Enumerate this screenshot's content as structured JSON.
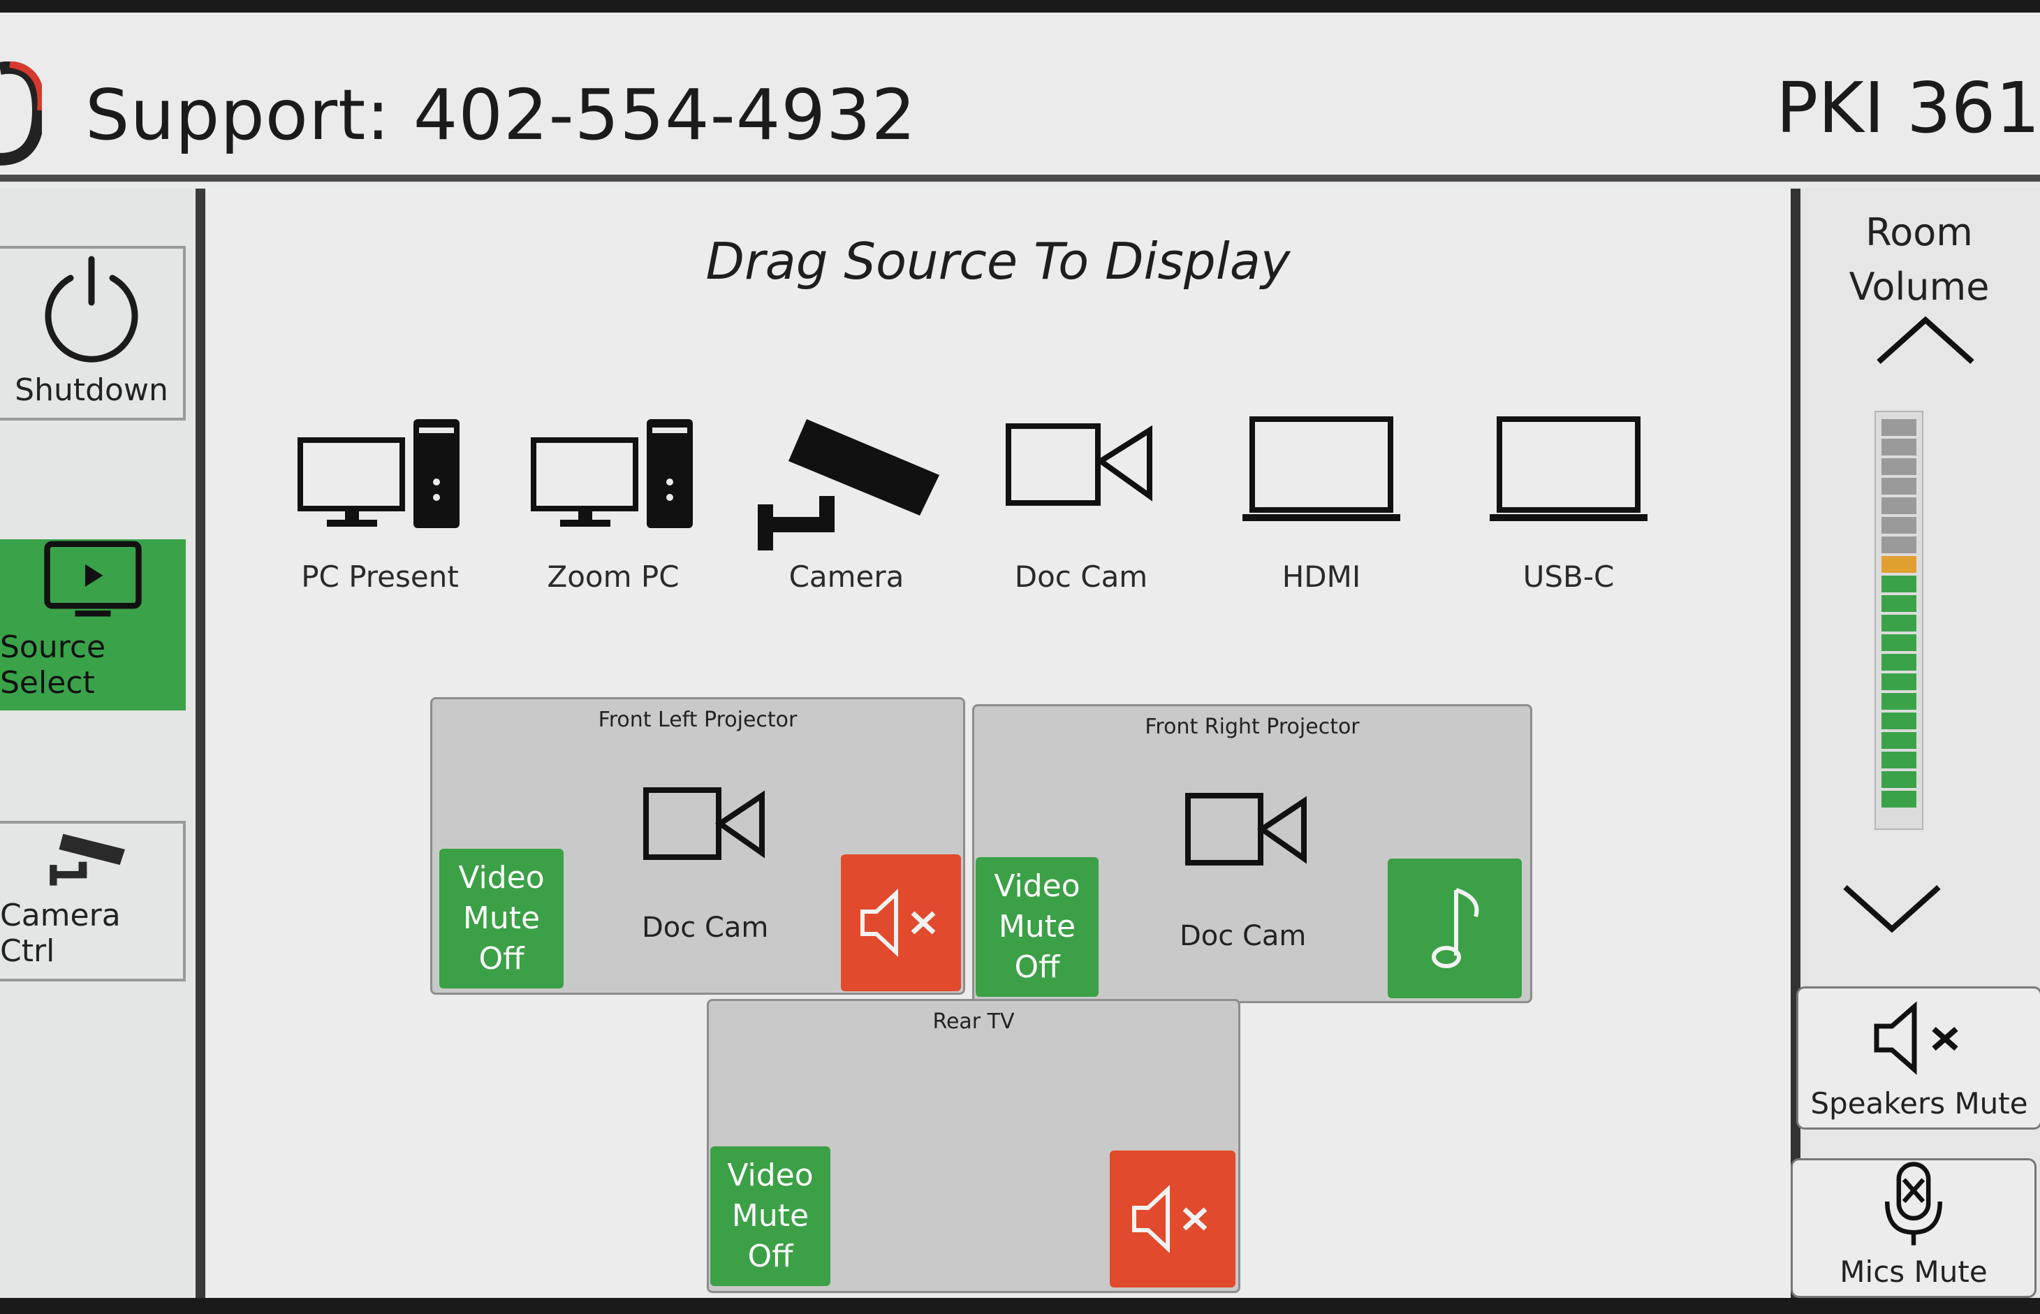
{
  "header": {
    "support_text": "Support: 402-554-4932",
    "room_name": "PKI 361"
  },
  "nav": {
    "shutdown_label": "Shutdown",
    "source_select_label": "Source Select",
    "camera_ctrl_label": "Camera Ctrl",
    "active": "Source Select"
  },
  "main": {
    "title": "Drag Source To Display",
    "sources": [
      {
        "label": "PC Present",
        "icon": "pc-icon"
      },
      {
        "label": "Zoom PC",
        "icon": "pc-icon"
      },
      {
        "label": "Camera",
        "icon": "security-camera-icon"
      },
      {
        "label": "Doc Cam",
        "icon": "video-camera-icon"
      },
      {
        "label": "HDMI",
        "icon": "laptop-icon"
      },
      {
        "label": "USB-C",
        "icon": "laptop-icon"
      }
    ]
  },
  "displays": {
    "front_left": {
      "title": "Front Left Projector",
      "source": "Doc Cam",
      "video_mute": "Video\nMute\nOff",
      "audio": "muted"
    },
    "front_right": {
      "title": "Front Right Projector",
      "source": "Doc Cam",
      "video_mute": "Video\nMute\nOff",
      "audio": "unmuted"
    },
    "rear_tv": {
      "title": "Rear TV",
      "video_mute": "Video\nMute\nOff",
      "audio": "muted"
    }
  },
  "video_mute_lines": [
    "Video",
    "Mute",
    "Off"
  ],
  "volume": {
    "title_line1": "Room",
    "title_line2": "Volume",
    "level_fraction": 0.6,
    "speakers_mute_label": "Speakers Mute",
    "mics_mute_label": "Mics Mute"
  },
  "colors": {
    "active_green": "#3aa34a",
    "mute_red": "#e14a2c",
    "meter_gray": "#9a9a9a",
    "meter_orange": "#e0a030"
  }
}
